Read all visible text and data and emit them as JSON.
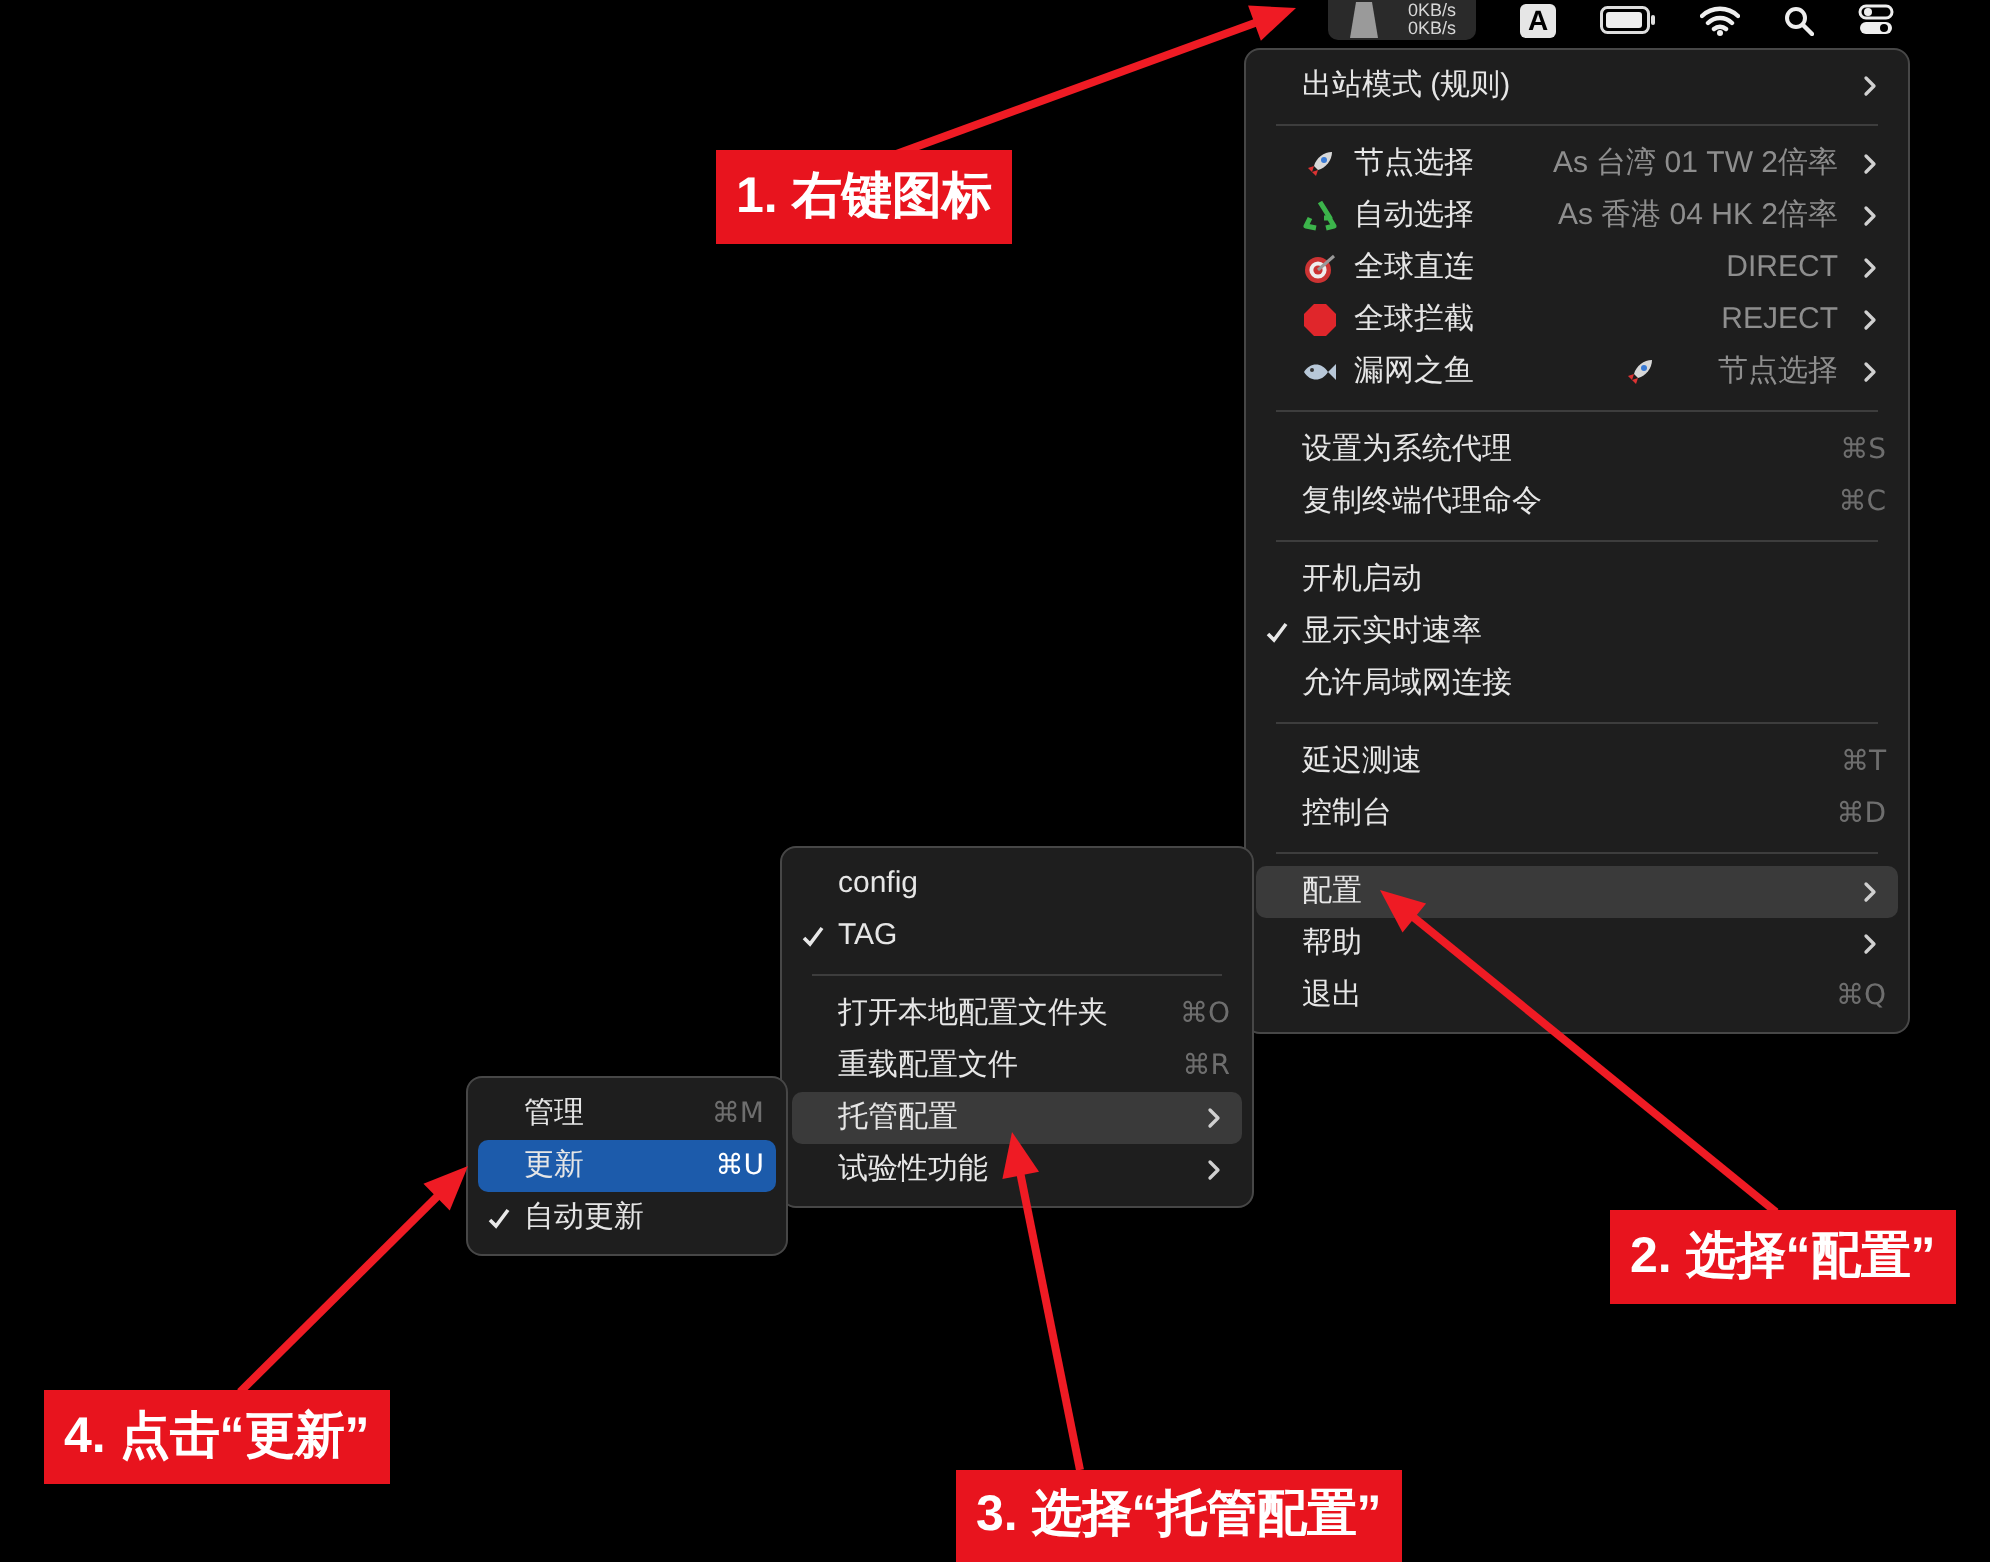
{
  "menu_bar": {
    "speed_up": "0KB/s",
    "speed_down": "0KB/s",
    "input_source": "A"
  },
  "main_menu": {
    "sections": [
      [
        {
          "label": "出站模式 (规则)",
          "submenu": true,
          "checked": false,
          "selected": false
        }
      ],
      [
        {
          "label": "节点选择",
          "value": "As 台湾 01 TW 2倍率",
          "submenu": true,
          "checked": false,
          "selected": false
        },
        {
          "label": "自动选择",
          "value": "As 香港 04 HK 2倍率",
          "submenu": true,
          "checked": false,
          "selected": false
        },
        {
          "label": "全球直连",
          "value": "DIRECT",
          "submenu": true,
          "checked": false,
          "selected": false
        },
        {
          "label": "全球拦截",
          "value": "REJECT",
          "submenu": true,
          "checked": false,
          "selected": false
        },
        {
          "label": "漏网之鱼",
          "value": "节点选择",
          "submenu": true,
          "checked": false,
          "selected": false
        }
      ],
      [
        {
          "label": "设置为系统代理",
          "shortcut": "⌘S",
          "submenu": false,
          "checked": false,
          "selected": false
        },
        {
          "label": "复制终端代理命令",
          "shortcut": "⌘C",
          "submenu": false,
          "checked": false,
          "selected": false
        }
      ],
      [
        {
          "label": "开机启动",
          "submenu": false,
          "checked": false,
          "selected": false
        },
        {
          "label": "显示实时速率",
          "submenu": false,
          "checked": true,
          "selected": false
        },
        {
          "label": "允许局域网连接",
          "submenu": false,
          "checked": false,
          "selected": false
        }
      ],
      [
        {
          "label": "延迟测速",
          "shortcut": "⌘T",
          "submenu": false,
          "checked": false,
          "selected": false
        },
        {
          "label": "控制台",
          "shortcut": "⌘D",
          "submenu": false,
          "checked": false,
          "selected": false
        }
      ],
      [
        {
          "label": "配置",
          "submenu": true,
          "checked": false,
          "selected": true
        },
        {
          "label": "帮助",
          "submenu": true,
          "checked": false,
          "selected": false
        },
        {
          "label": "退出",
          "shortcut": "⌘Q",
          "submenu": false,
          "checked": false,
          "selected": false
        }
      ]
    ]
  },
  "config_menu": {
    "sections": [
      [
        {
          "label": "config",
          "submenu": false,
          "checked": false,
          "selected": false
        },
        {
          "label": "TAG",
          "submenu": false,
          "checked": true,
          "selected": false
        }
      ],
      [
        {
          "label": "打开本地配置文件夹",
          "shortcut": "⌘O",
          "submenu": false,
          "checked": false,
          "selected": false
        },
        {
          "label": "重载配置文件",
          "shortcut": "⌘R",
          "submenu": false,
          "checked": false,
          "selected": false
        },
        {
          "label": "托管配置",
          "submenu": true,
          "checked": false,
          "selected": true
        },
        {
          "label": "试验性功能",
          "submenu": true,
          "checked": false,
          "selected": false
        }
      ]
    ]
  },
  "remote_menu": {
    "sections": [
      [
        {
          "label": "管理",
          "shortcut": "⌘M",
          "submenu": false,
          "checked": false,
          "selected": false
        },
        {
          "label": "更新",
          "shortcut": "⌘U",
          "submenu": false,
          "checked": false,
          "selected": true
        },
        {
          "label": "自动更新",
          "submenu": false,
          "checked": true,
          "selected": false
        }
      ]
    ]
  },
  "annotations": [
    {
      "text": "1. 右键图标"
    },
    {
      "text": "2. 选择“配置”"
    },
    {
      "text": "3. 选择“托管配置”"
    },
    {
      "text": "4. 点击“更新”"
    }
  ]
}
